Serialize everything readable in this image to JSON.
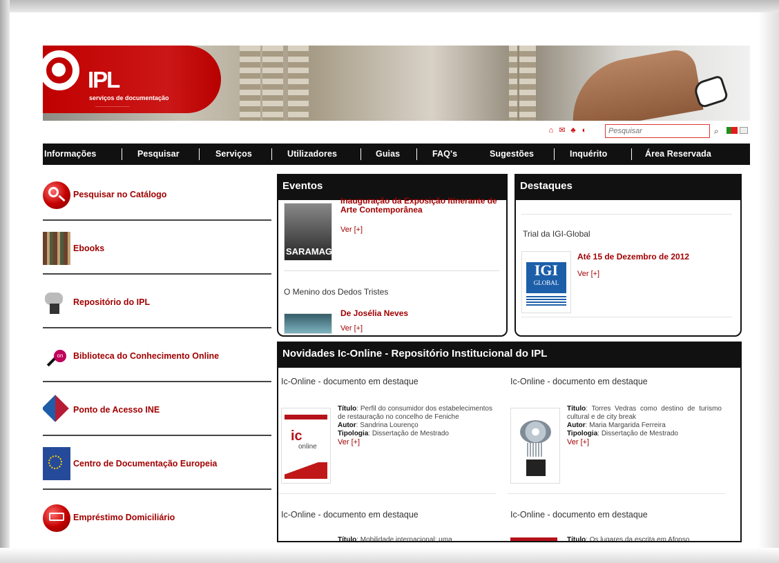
{
  "brand": {
    "name": "IPL",
    "subtitle": "serviços de documentação"
  },
  "utility": {
    "search_placeholder": "Pesquisar",
    "flag_colors": [
      "#1c8f1c",
      "#e31b1b"
    ],
    "icons": [
      "home-icon",
      "mail-icon",
      "sitemap-icon",
      "accessibility-icon",
      "search-icon"
    ]
  },
  "navigation": [
    "Informações",
    "Pesquisar",
    "Serviços",
    "Utilizadores",
    "Guias",
    "FAQ's",
    "Sugestões",
    "Inquérito",
    "Área Reservada"
  ],
  "left_menu": [
    {
      "label": "Pesquisar no Catálogo",
      "icon": "magnifier-icon"
    },
    {
      "label": "Ebooks",
      "icon": "books-icon"
    },
    {
      "label": "Repositório do IPL",
      "icon": "server-icon"
    },
    {
      "label": "Biblioteca do Conhecimento Online",
      "icon": "b-on-icon"
    },
    {
      "label": "Ponto de Acesso INE",
      "icon": "ine-icon"
    },
    {
      "label": "Centro de Documentação Europeia",
      "icon": "european-documentation-icon"
    },
    {
      "label": "Empréstimo Domiciliário",
      "icon": "book-loan-icon"
    }
  ],
  "events": {
    "title": "Eventos",
    "items": [
      {
        "title": "Inauguração da Exposição Itinerante de Arte Contemporânea",
        "thumb_text": "SARAMAGO",
        "more": "Ver [+]"
      },
      {
        "heading": "O Menino dos Dedos Tristes",
        "title": "De Josélia Neves",
        "more": "Ver [+]"
      }
    ]
  },
  "highlights": {
    "title": "Destaques",
    "item": {
      "heading": "Trial da IGI-Global",
      "title": "Até 15 de Dezembro de 2012",
      "logo_text": "IGI",
      "logo_sub": "GLOBAL",
      "more": "Ver [+]"
    }
  },
  "news": {
    "title": "Novidades Ic-Online - Repositório Institucional do IPL",
    "documents": [
      {
        "heading": "Ic-Online - documento em destaque",
        "titulo": "Perfil do consumidor dos estabelecimentos de restauração no concelho de Feniche",
        "autor": "Sandrina Lourenço",
        "tipologia": "Dissertação de Mestrado",
        "more": "Ver [+]",
        "thumb": "ic-online-logo"
      },
      {
        "heading": "Ic-Online - documento em destaque",
        "titulo": "Torres Vedras como destino de turismo cultural e de city break",
        "autor": "Maria Margarida Ferreira",
        "tipologia": "Dissertação de Mestrado",
        "more": "Ver [+]",
        "thumb": "brain-chip-image"
      },
      {
        "heading": "Ic-Online - documento em destaque",
        "titulo": "Mobilidade internacional: uma",
        "autor": "",
        "tipologia": "",
        "more": "",
        "thumb": "document-thumb"
      },
      {
        "heading": "Ic-Online - documento em destaque",
        "titulo": "Os lugares da escrita em Afonso",
        "autor": "",
        "tipologia": "",
        "more": "",
        "thumb": "document-thumb"
      }
    ],
    "labels": {
      "titulo": "Título",
      "autor": "Autor",
      "tipologia": "Tipologia"
    }
  }
}
